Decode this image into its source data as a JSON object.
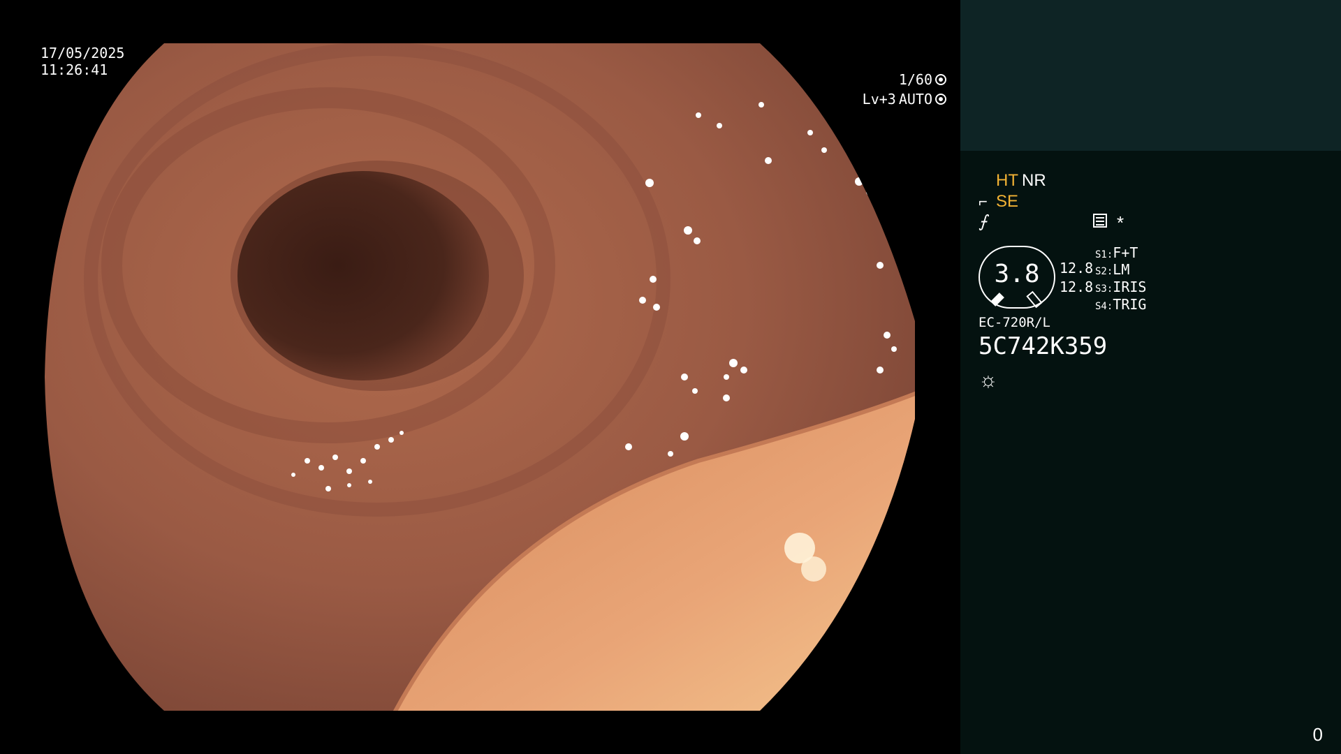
{
  "osd": {
    "date": "17/05/2025",
    "time": "11:26:41",
    "shutter": "1/60",
    "shutter_icon": "shutter-icon",
    "level": "Lv+3",
    "iris": "AUTO",
    "iris_icon": "iris-icon"
  },
  "panel": {
    "ht": "HT",
    "nr": "NR",
    "se": "SE",
    "se_icon": "structure-enhance-icon",
    "freeze_icon": "freeze-icon",
    "freeze_glyph": "⨍",
    "menu_icon": "menu-icon",
    "star": "*",
    "dial_value": "3.8",
    "value1": "12.8",
    "value2": "12.8",
    "switches": [
      {
        "key": "S1",
        "value": "F+T"
      },
      {
        "key": "S2",
        "value": "LM"
      },
      {
        "key": "S3",
        "value": "IRIS"
      },
      {
        "key": "S4",
        "value": "TRIG"
      }
    ],
    "model": "EC-720R/L",
    "serial": "5C742K359",
    "light_icon": "light-icon",
    "light_glyph": "☼",
    "counter": "0"
  },
  "colors": {
    "accent": "#f2b234",
    "panel_bg": "#041210",
    "panel_top_bg": "#0e2425"
  }
}
